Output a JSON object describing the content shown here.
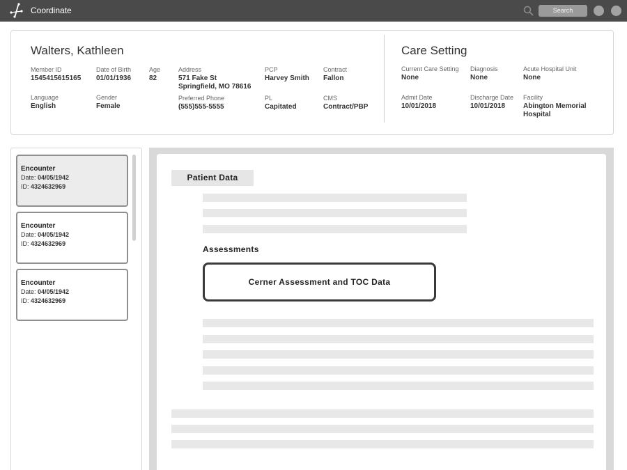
{
  "app": {
    "title": "Coordinate"
  },
  "topbar": {
    "search_label": "Search"
  },
  "patient": {
    "name": "Walters, Kathleen",
    "member_id": {
      "label": "Member ID",
      "value": "1545415615165"
    },
    "dob": {
      "label": "Date of Birth",
      "value": "01/01/1936"
    },
    "age": {
      "label": "Age",
      "value": "82"
    },
    "address": {
      "label": "Address",
      "value": "571 Fake St\nSpringfield, MO 78616"
    },
    "pcp": {
      "label": "PCP",
      "value": "Harvey Smith"
    },
    "contract": {
      "label": "Contract",
      "value": "Fallon"
    },
    "language": {
      "label": "Language",
      "value": "English"
    },
    "gender": {
      "label": "Gender",
      "value": "Female"
    },
    "phone": {
      "label": "Preferred Phone",
      "value": "(555)555-5555"
    },
    "pl": {
      "label": "PL",
      "value": "Capitated"
    },
    "cms": {
      "label": "CMS",
      "value": "Contract/PBP"
    }
  },
  "care_setting": {
    "title": "Care Setting",
    "current": {
      "label": "Current Care Setting",
      "value": "None"
    },
    "diagnosis": {
      "label": "Diagnosis",
      "value": "None"
    },
    "unit": {
      "label": "Acute Hospital Unit",
      "value": "None"
    },
    "admit": {
      "label": "Admit Date",
      "value": "10/01/2018"
    },
    "discharge": {
      "label": "Discharge Date",
      "value": "10/01/2018"
    },
    "facility": {
      "label": "Facility",
      "value": "Abington Memorial\nHospital"
    }
  },
  "encounters": [
    {
      "title": "Encounter",
      "date_label": "Date: ",
      "date": "04/05/1942",
      "id_label": "ID: ",
      "id": "4324632969",
      "selected": true
    },
    {
      "title": "Encounter",
      "date_label": "Date: ",
      "date": "04/05/1942",
      "id_label": "ID: ",
      "id": "4324632969",
      "selected": false
    },
    {
      "title": "Encounter",
      "date_label": "Date: ",
      "date": "04/05/1942",
      "id_label": "ID: ",
      "id": "4324632969",
      "selected": false
    }
  ],
  "main": {
    "tab_label": "Patient Data",
    "assessments_title": "Assessments",
    "assessment_button": "Cerner Assessment and TOC Data"
  }
}
